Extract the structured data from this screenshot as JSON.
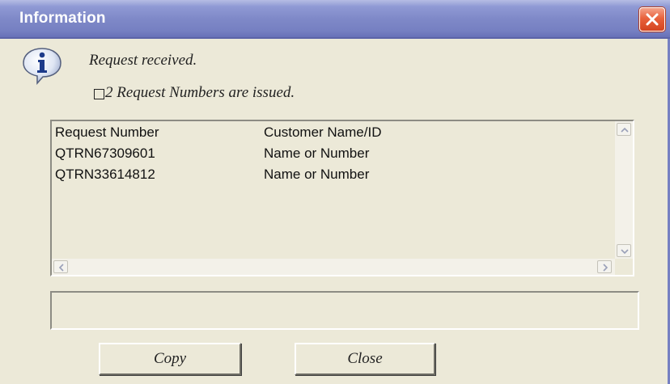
{
  "window": {
    "title": "Information",
    "close_icon": "close-icon"
  },
  "message": {
    "icon": "info-icon",
    "line1": "Request received.",
    "line2": "2 Request Numbers are issued."
  },
  "list": {
    "columns": [
      "Request Number",
      "Customer Name/ID"
    ],
    "rows": [
      [
        "QTRN67309601",
        "Name or Number"
      ],
      [
        "QTRN33614812",
        "Name or Number"
      ]
    ]
  },
  "text_box": {
    "value": ""
  },
  "buttons": {
    "copy": "Copy",
    "close": "Close"
  },
  "colors": {
    "titlebar": "#7f89c8",
    "dialog_bg": "#ece9d8",
    "close_button": "#e8623c"
  }
}
